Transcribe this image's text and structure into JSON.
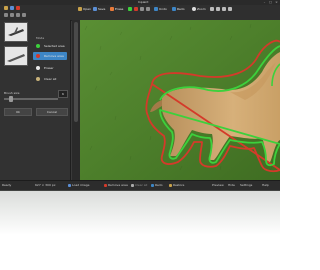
{
  "app": {
    "title": "Inpaint"
  },
  "window_controls": [
    "–",
    "□",
    "×"
  ],
  "toolbar": {
    "buttons": [
      {
        "label": "Open"
      },
      {
        "label": "Save"
      },
      {
        "label": "Erase"
      },
      {
        "label": "Undo"
      },
      {
        "label": "Redo"
      },
      {
        "label": "Zoom"
      }
    ],
    "colors": {
      "accent": "#3d86c6",
      "red": "#d43a2a",
      "green": "#3cd13c"
    }
  },
  "sidebar": {
    "mode_heading": "Mode",
    "modes": [
      {
        "label": "Selected area",
        "color": "#3cd13c",
        "active": false
      },
      {
        "label": "Remove area",
        "color": "#d43a2a",
        "active": true
      },
      {
        "label": "Eraser",
        "color": "#e8e8e8",
        "active": false
      },
      {
        "label": "Clear all",
        "color": "#c8b27a",
        "active": false
      }
    ],
    "brush_label": "Brush size",
    "brush_value": "6",
    "brush_level": 0.1,
    "buttons": {
      "ok": "Ok",
      "cancel": "Cancel"
    }
  },
  "statusbar": {
    "left_text": "Ready",
    "coords": "627 × 300 px",
    "tools": [
      "Load image",
      "Remove area",
      "Clear all",
      "Redo",
      "Restore"
    ],
    "right_tools": [
      "Preview",
      "Hide",
      "Settings",
      "Help"
    ]
  }
}
